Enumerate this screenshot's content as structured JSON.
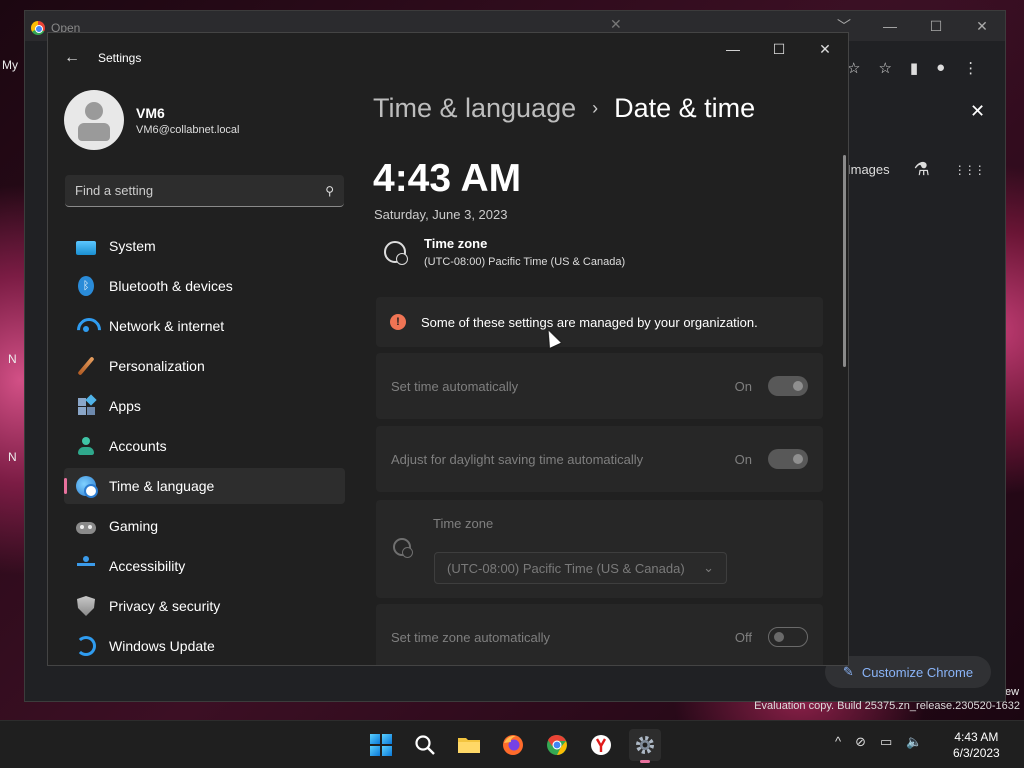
{
  "desktop": {
    "left_labels": [
      "My",
      "N",
      "N"
    ],
    "evaluation_text": "Evaluation copy. Build 25375.zn_release.230520-1632",
    "corner_text": "ew"
  },
  "chrome": {
    "tab_title": "Open",
    "tab_close": "✕",
    "window_controls": [
      "﹀",
      "—",
      "☐",
      "✕"
    ],
    "toolbar_icons": [
      "☆",
      "☆",
      "▮",
      "●",
      "⋮"
    ],
    "close_glyph": "✕",
    "images_label": "Images",
    "labs_icon": "⚗",
    "apps_icon": "⋮⋮⋮",
    "customize_label": "Customize Chrome",
    "customize_icon": "✎"
  },
  "settings": {
    "app_title": "Settings",
    "back_glyph": "←",
    "window_controls": [
      "—",
      "☐",
      "✕"
    ],
    "user": {
      "name": "VM6",
      "email": "VM6@collabnet.local"
    },
    "search": {
      "placeholder": "Find a setting",
      "icon": "⚲"
    },
    "nav": [
      {
        "label": "System",
        "icon": "system-icon"
      },
      {
        "label": "Bluetooth & devices",
        "icon": "bluetooth-icon"
      },
      {
        "label": "Network & internet",
        "icon": "wifi-icon"
      },
      {
        "label": "Personalization",
        "icon": "brush-icon"
      },
      {
        "label": "Apps",
        "icon": "apps-icon"
      },
      {
        "label": "Accounts",
        "icon": "accounts-icon"
      },
      {
        "label": "Time & language",
        "icon": "time-language-icon",
        "active": true
      },
      {
        "label": "Gaming",
        "icon": "gaming-icon"
      },
      {
        "label": "Accessibility",
        "icon": "accessibility-icon"
      },
      {
        "label": "Privacy & security",
        "icon": "shield-icon"
      },
      {
        "label": "Windows Update",
        "icon": "update-icon"
      }
    ],
    "breadcrumb": {
      "parent": "Time & language",
      "separator": "›",
      "current": "Date & time"
    },
    "current_time": "4:43 AM",
    "current_date": "Saturday, June 3, 2023",
    "timezone": {
      "label": "Time zone",
      "value": "(UTC-08:00) Pacific Time (US & Canada)"
    },
    "info_banner": {
      "icon": "!",
      "text": "Some of these settings are managed by your organization."
    },
    "settings_rows": [
      {
        "label": "Set time automatically",
        "state": "On"
      },
      {
        "label": "Adjust for daylight saving time automatically",
        "state": "On"
      },
      {
        "label": "Set time zone automatically",
        "state": "Off"
      }
    ],
    "timezone_card": {
      "label": "Time zone",
      "selected": "(UTC-08:00) Pacific Time (US & Canada)",
      "chevron": "⌄"
    },
    "accent_color": "#e8719d"
  },
  "taskbar": {
    "clock_time": "4:43 AM",
    "clock_date": "6/3/2023",
    "tray_icons": [
      "^",
      "⊘",
      "▭",
      "🔈"
    ]
  }
}
